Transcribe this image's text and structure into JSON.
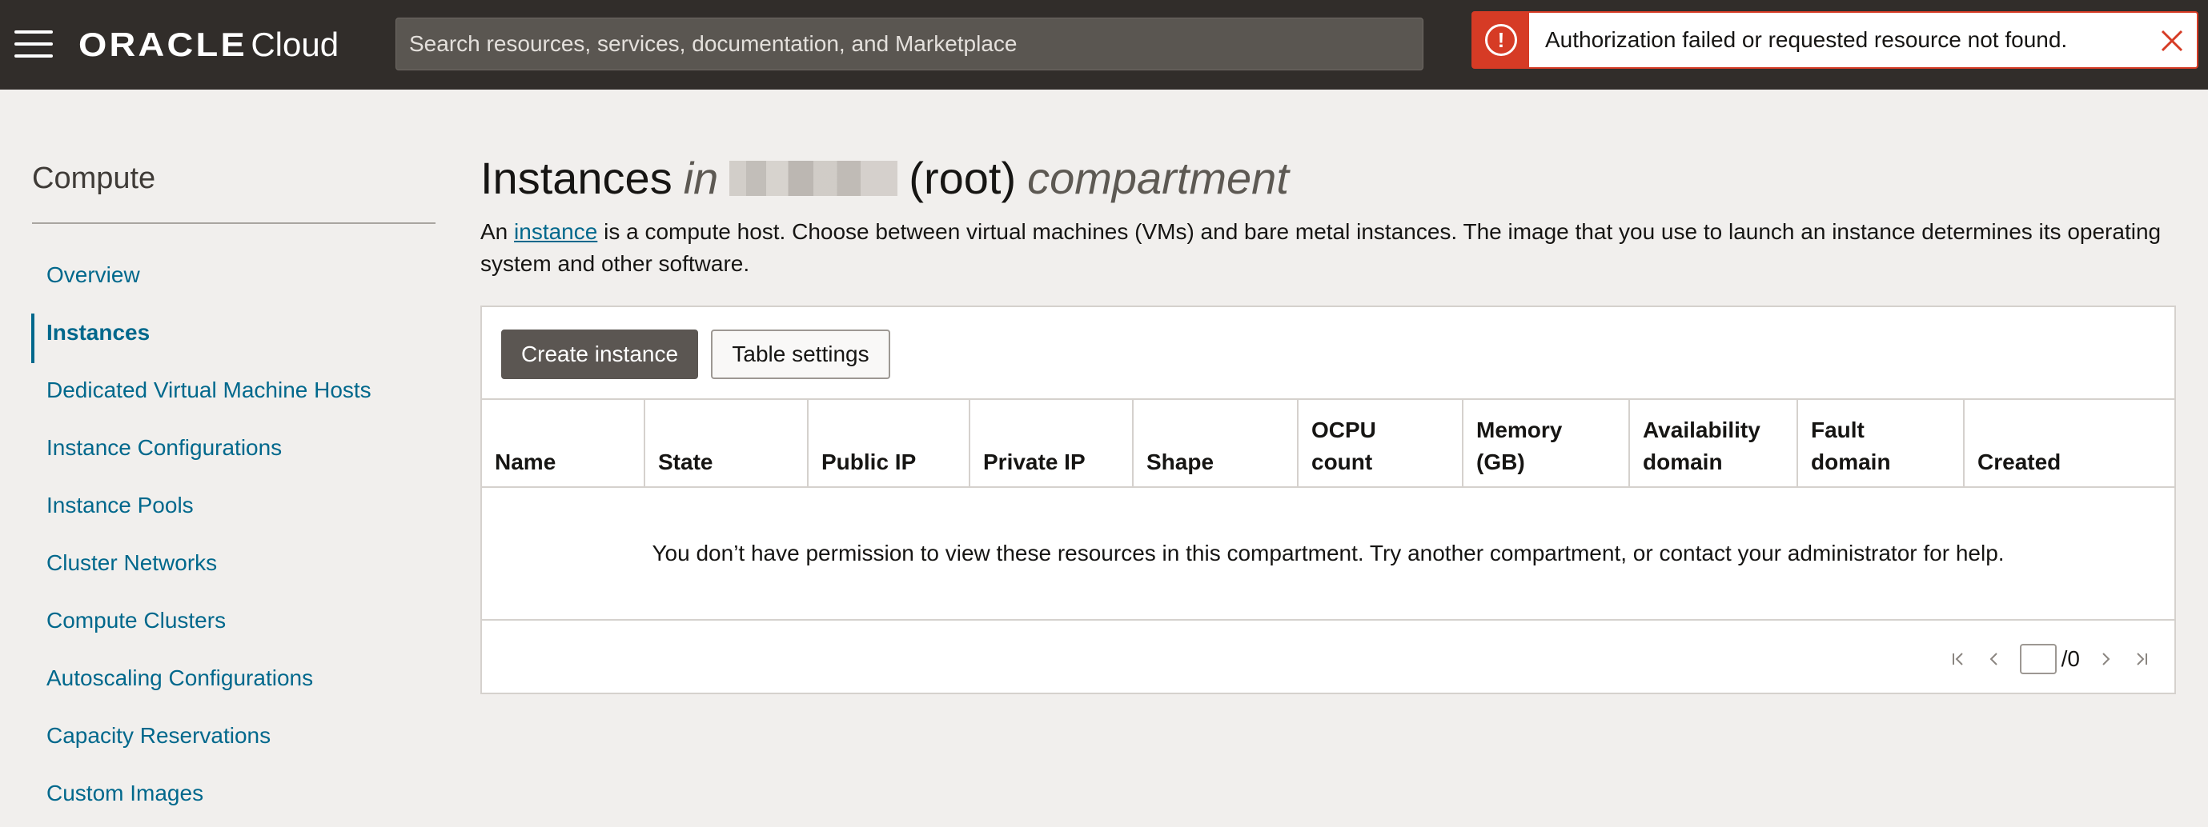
{
  "header": {
    "logo_brand": "ORACLE",
    "logo_product": "Cloud",
    "search_placeholder": "Search resources, services, documentation, and Marketplace",
    "alert_icon": "!",
    "alert_message": "Authorization failed or requested resource not found.",
    "alert_color": "#d63b25"
  },
  "sidebar": {
    "title": "Compute",
    "items": [
      {
        "label": "Overview"
      },
      {
        "label": "Instances"
      },
      {
        "label": "Dedicated Virtual Machine Hosts"
      },
      {
        "label": "Instance Configurations"
      },
      {
        "label": "Instance Pools"
      },
      {
        "label": "Cluster Networks"
      },
      {
        "label": "Compute Clusters"
      },
      {
        "label": "Autoscaling Configurations"
      },
      {
        "label": "Capacity Reservations"
      },
      {
        "label": "Custom Images"
      }
    ],
    "active_item": "Instances"
  },
  "main": {
    "title_prefix": "Instances",
    "title_in": "in",
    "title_root": "(root)",
    "title_suffix": "compartment",
    "description_prefix": "An",
    "description_link": "instance",
    "description_rest": "is a compute host. Choose between virtual machines (VMs) and bare metal instances. The image that you use to launch an instance determines its operating system and other software.",
    "create_button": "Create instance",
    "settings_button": "Table settings",
    "columns": [
      {
        "line1": "Name",
        "line2": ""
      },
      {
        "line1": "State",
        "line2": ""
      },
      {
        "line1": "Public IP",
        "line2": ""
      },
      {
        "line1": "Private IP",
        "line2": ""
      },
      {
        "line1": "Shape",
        "line2": ""
      },
      {
        "line1": "OCPU",
        "line2": "count"
      },
      {
        "line1": "Memory",
        "line2": "(GB)"
      },
      {
        "line1": "Availability",
        "line2": "domain"
      },
      {
        "line1": "Fault",
        "line2": "domain"
      },
      {
        "line1": "Created",
        "line2": ""
      }
    ],
    "empty_message": "You don’t have permission to view these resources in this compartment. Try another compartment, or contact your administrator for help.",
    "pager_total": "/0",
    "pager_value": ""
  },
  "colors": {
    "header_bg": "#312d2a",
    "link": "#00688c",
    "primary_button": "#5b5652",
    "page_bg": "#f1efed"
  }
}
